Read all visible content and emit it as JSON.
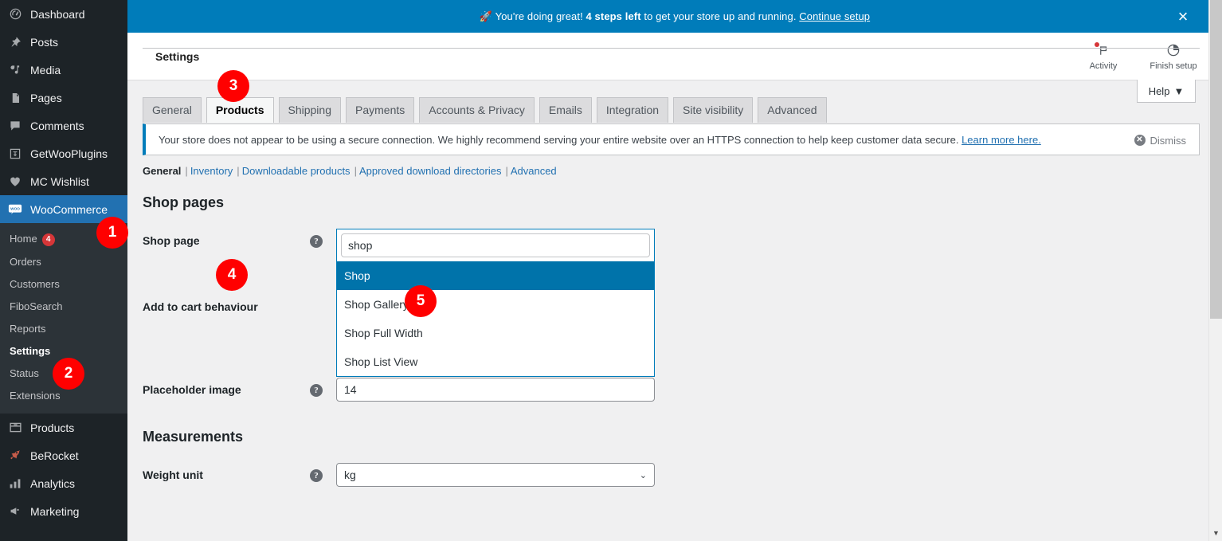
{
  "sidebar": {
    "items": [
      {
        "label": "Dashboard",
        "icon": "dashboard-icon"
      },
      {
        "label": "Posts",
        "icon": "pin-icon"
      },
      {
        "label": "Media",
        "icon": "media-icon"
      },
      {
        "label": "Pages",
        "icon": "pages-icon"
      },
      {
        "label": "Comments",
        "icon": "comments-icon"
      },
      {
        "label": "GetWooPlugins",
        "icon": "plugin-icon"
      },
      {
        "label": "MC Wishlist",
        "icon": "heart-icon"
      },
      {
        "label": "WooCommerce",
        "icon": "woocommerce-icon"
      }
    ],
    "submenu": [
      {
        "label": "Home",
        "badge": "4"
      },
      {
        "label": "Orders",
        "badge": ""
      },
      {
        "label": "Customers",
        "badge": ""
      },
      {
        "label": "FiboSearch",
        "badge": ""
      },
      {
        "label": "Reports",
        "badge": ""
      },
      {
        "label": "Settings",
        "badge": ""
      },
      {
        "label": "Status",
        "badge": ""
      },
      {
        "label": "Extensions",
        "badge": ""
      }
    ],
    "items_after": [
      {
        "label": "Products",
        "icon": "products-icon"
      },
      {
        "label": "BeRocket",
        "icon": "rocket-icon"
      },
      {
        "label": "Analytics",
        "icon": "analytics-icon"
      },
      {
        "label": "Marketing",
        "icon": "megaphone-icon"
      }
    ]
  },
  "banner": {
    "emoji": "🚀",
    "text_before": "You're doing great! ",
    "bold": "4 steps left",
    "text_after": " to get your store up and running. ",
    "link": "Continue setup",
    "close_label": "×",
    "bg_color": "#007cba"
  },
  "header": {
    "title": "Settings",
    "activity_label": "Activity",
    "finish_setup_label": "Finish setup",
    "help_label": "Help"
  },
  "tabs": [
    {
      "label": "General",
      "active": false
    },
    {
      "label": "Products",
      "active": true
    },
    {
      "label": "Shipping",
      "active": false
    },
    {
      "label": "Payments",
      "active": false
    },
    {
      "label": "Accounts & Privacy",
      "active": false
    },
    {
      "label": "Emails",
      "active": false
    },
    {
      "label": "Integration",
      "active": false
    },
    {
      "label": "Site visibility",
      "active": false
    },
    {
      "label": "Advanced",
      "active": false
    }
  ],
  "notice": {
    "text": "Your store does not appear to be using a secure connection. We highly recommend serving your entire website over an HTTPS connection to help keep customer data secure. ",
    "link": "Learn more here.",
    "dismiss": "Dismiss",
    "accent": "#007cba"
  },
  "subnav": [
    {
      "label": "General",
      "current": true
    },
    {
      "label": "Inventory",
      "current": false
    },
    {
      "label": "Downloadable products",
      "current": false
    },
    {
      "label": "Approved download directories",
      "current": false
    },
    {
      "label": "Advanced",
      "current": false
    }
  ],
  "form": {
    "shop_pages_title": "Shop pages",
    "shop_page_label": "Shop page",
    "shop_page_search_value": "shop",
    "shop_page_options": [
      {
        "label": "Shop",
        "selected": true
      },
      {
        "label": "Shop Gallery View",
        "selected": false
      },
      {
        "label": "Shop Full Width",
        "selected": false
      },
      {
        "label": "Shop List View",
        "selected": false
      }
    ],
    "add_to_cart_label": "Add to cart behaviour",
    "placeholder_image_label": "Placeholder image",
    "placeholder_image_value": "14",
    "measurements_title": "Measurements",
    "weight_unit_label": "Weight unit",
    "weight_unit_value": "kg",
    "help_glyph": "?"
  },
  "callouts": [
    {
      "n": "1"
    },
    {
      "n": "2"
    },
    {
      "n": "3"
    },
    {
      "n": "4"
    },
    {
      "n": "5"
    }
  ]
}
